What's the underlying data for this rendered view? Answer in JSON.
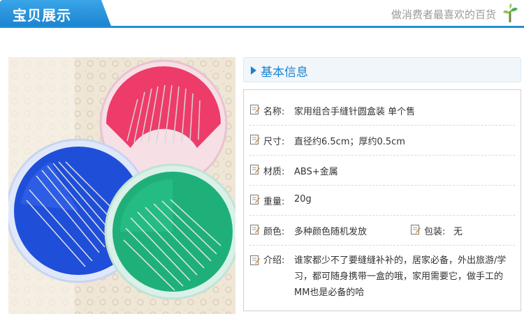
{
  "header": {
    "title": "宝贝展示",
    "slogan": "做消费者最喜欢的百货"
  },
  "info": {
    "section_title": "基本信息",
    "rows": {
      "name": {
        "label": "名称:",
        "value": "家用组合手缝针圆盒装 单个售"
      },
      "size": {
        "label": "尺寸:",
        "value": "直径约6.5cm；厚约0.5cm"
      },
      "material": {
        "label": "材质:",
        "value": "ABS+金属"
      },
      "weight": {
        "label": "重量:",
        "value": "20g"
      },
      "color": {
        "label": "颜色:",
        "value": "多种颜色随机发放"
      },
      "package": {
        "label": "包装:",
        "value": "无"
      },
      "intro": {
        "label": "介绍:",
        "line1": "谁家都少不了要缝缝补补的，居家必备，外出旅游/学",
        "line2": "习，都可随身携带一盒的哦，家用需要它，做手工的",
        "line3": "MM也是必备的哈"
      }
    }
  },
  "colors": {
    "brand_blue": "#1a82cf",
    "case_red": "#ee3c6a",
    "case_blue": "#1f4fd8",
    "case_green": "#1fb07a"
  }
}
